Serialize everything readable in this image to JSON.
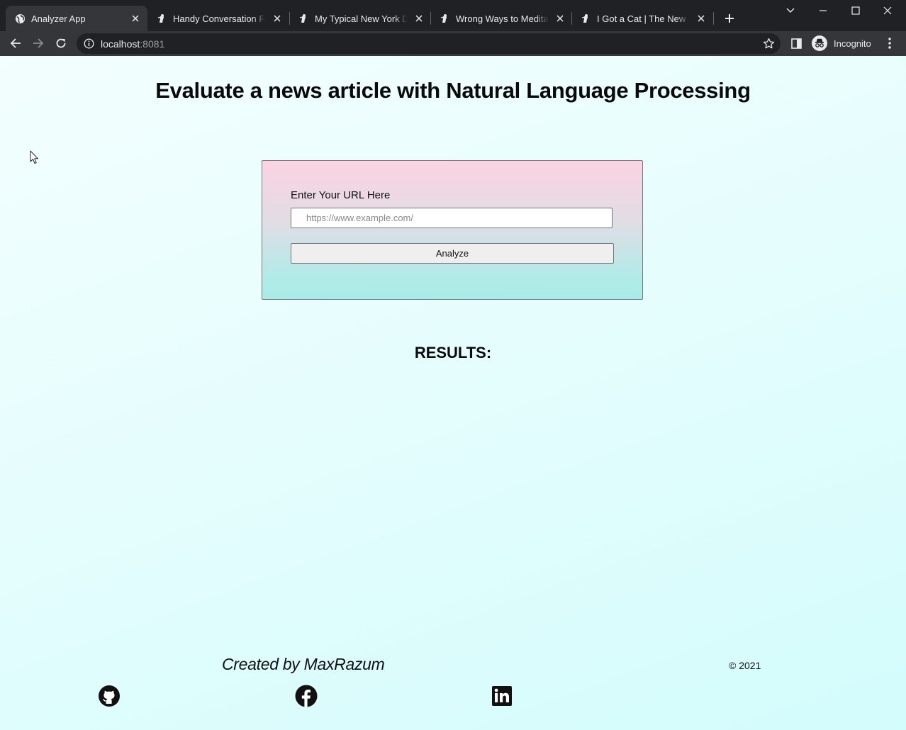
{
  "browser": {
    "tabs": [
      {
        "title": "Analyzer App",
        "active": true
      },
      {
        "title": "Handy Conversation Filler",
        "active": false
      },
      {
        "title": "My Typical New York Day",
        "active": false
      },
      {
        "title": "Wrong Ways to Meditate",
        "active": false
      },
      {
        "title": "I Got a Cat | The New York",
        "active": false
      }
    ],
    "address": {
      "host": "localhost",
      "port": ":8081"
    },
    "profile_label": "Incognito"
  },
  "page": {
    "heading": "Evaluate a news article with Natural Language Processing",
    "form": {
      "label": "Enter Your URL Here",
      "input_value": "",
      "input_placeholder": "https://www.example.com/",
      "submit_label": "Analyze"
    },
    "results_title": "RESULTS:",
    "footer": {
      "credit": "Created by MaxRazum",
      "copyright": "© 2021",
      "social_icons": [
        "github-icon",
        "facebook-icon",
        "linkedin-icon"
      ]
    }
  },
  "colors": {
    "chrome_dark": "#202124",
    "chrome_toolbar": "#35363a",
    "page_background": "#e3fdfd",
    "card_gradient_top": "#fcd3e1",
    "card_gradient_bottom": "#a9ebe6"
  }
}
